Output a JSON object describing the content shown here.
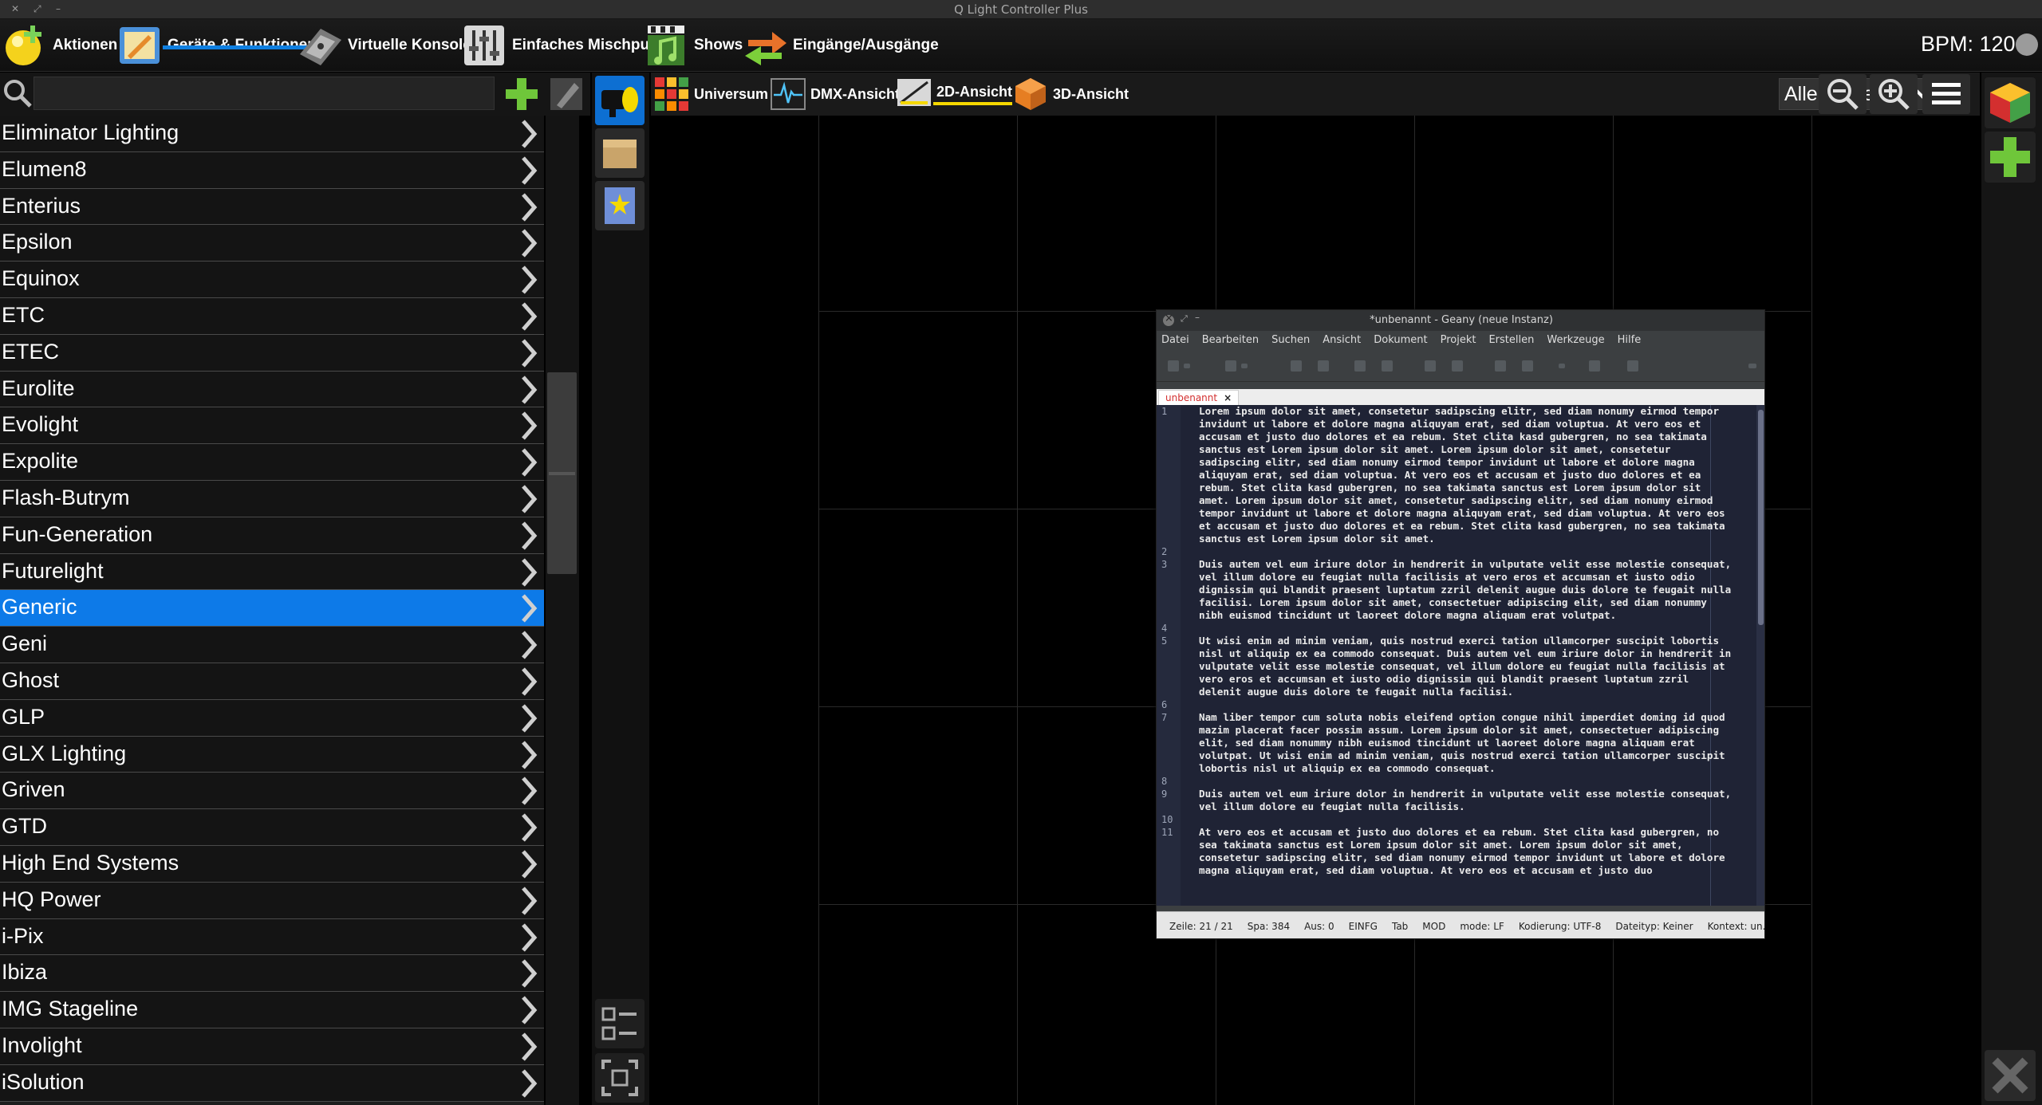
{
  "window": {
    "title": "Q Light Controller Plus"
  },
  "main_tabs": [
    {
      "label": "Aktionen",
      "icon": "bulb-icon"
    },
    {
      "label": "Geräte & Funktionen",
      "icon": "fixture-editor-icon",
      "active": true
    },
    {
      "label": "Virtuelle Konsole",
      "icon": "virtual-console-icon"
    },
    {
      "label": "Einfaches Mischpult",
      "icon": "mixer-icon"
    },
    {
      "label": "Shows",
      "icon": "shows-icon"
    },
    {
      "label": "Eingänge/Ausgänge",
      "icon": "io-arrows-icon"
    }
  ],
  "bpm": {
    "label": "BPM: 120"
  },
  "search": {
    "placeholder": "",
    "value": ""
  },
  "manufacturers": [
    "Eliminator Lighting",
    "Elumen8",
    "Enterius",
    "Epsilon",
    "Equinox",
    "ETC",
    "ETEC",
    "Eurolite",
    "Evolight",
    "Expolite",
    "Flash-Butrym",
    "Fun-Generation",
    "Futurelight",
    "Generic",
    "Geni",
    "Ghost",
    "GLP",
    "GLX Lighting",
    "Griven",
    "GTD",
    "High End Systems",
    "HQ Power",
    "i-Pix",
    "Ibiza",
    "IMG Stageline",
    "Involight",
    "iSolution"
  ],
  "selected_manufacturer": "Generic",
  "context_tabs": [
    {
      "label": "Universum",
      "icon": "universe-grid-icon"
    },
    {
      "label": "DMX-Ansicht",
      "icon": "dmx-wave-icon"
    },
    {
      "label": "2D-Ansicht",
      "icon": "view2d-icon",
      "active": true
    },
    {
      "label": "3D-Ansicht",
      "icon": "cube-icon"
    }
  ],
  "universe_select": {
    "value": "Alle Universen"
  },
  "colors": {
    "accent": "#0d7ae8",
    "active_tab_underline": "#f5d800",
    "list_bg": "#141414"
  },
  "geany": {
    "title": "*unbenannt - Geany (neue Instanz)",
    "menu": [
      "Datei",
      "Bearbeiten",
      "Suchen",
      "Ansicht",
      "Dokument",
      "Projekt",
      "Erstellen",
      "Werkzeuge",
      "Hilfe"
    ],
    "tab": "unbenannt",
    "lines": [
      {
        "no": "1",
        "text": "Lorem ipsum dolor sit amet, consetetur sadipscing elitr, sed diam nonumy eirmod tempor invidunt ut labore et dolore magna aliquyam erat, sed diam voluptua. At vero eos et accusam et justo duo dolores et ea rebum. Stet clita kasd gubergren, no sea takimata sanctus est Lorem ipsum dolor sit amet. Lorem ipsum dolor sit amet, consetetur sadipscing elitr, sed diam nonumy eirmod tempor invidunt ut labore et dolore magna aliquyam erat, sed diam voluptua. At vero eos et accusam et justo duo dolores et ea rebum. Stet clita kasd gubergren, no sea takimata sanctus est Lorem ipsum dolor sit amet. Lorem ipsum dolor sit amet, consetetur sadipscing elitr, sed diam nonumy eirmod tempor invidunt ut labore et dolore magna aliquyam erat, sed diam voluptua. At vero eos et accusam et justo duo dolores et ea rebum. Stet clita kasd gubergren, no sea takimata sanctus est Lorem ipsum dolor sit amet."
      },
      {
        "no": "2",
        "text": ""
      },
      {
        "no": "3",
        "text": "Duis autem vel eum iriure dolor in hendrerit in vulputate velit esse molestie consequat, vel illum dolore eu feugiat nulla facilisis at vero eros et accumsan et iusto odio dignissim qui blandit praesent luptatum zzril delenit augue duis dolore te feugait nulla facilisi. Lorem ipsum dolor sit amet, consectetuer adipiscing elit, sed diam nonummy nibh euismod tincidunt ut laoreet dolore magna aliquam erat volutpat."
      },
      {
        "no": "4",
        "text": ""
      },
      {
        "no": "5",
        "text": "Ut wisi enim ad minim veniam, quis nostrud exerci tation ullamcorper suscipit lobortis nisl ut aliquip ex ea commodo consequat. Duis autem vel eum iriure dolor in hendrerit in vulputate velit esse molestie consequat, vel illum dolore eu feugiat nulla facilisis at vero eros et accumsan et iusto odio dignissim qui blandit praesent luptatum zzril delenit augue duis dolore te feugait nulla facilisi."
      },
      {
        "no": "6",
        "text": ""
      },
      {
        "no": "7",
        "text": "Nam liber tempor cum soluta nobis eleifend option congue nihil imperdiet doming id quod mazim placerat facer possim assum. Lorem ipsum dolor sit amet, consectetuer adipiscing elit, sed diam nonummy nibh euismod tincidunt ut laoreet dolore magna aliquam erat volutpat. Ut wisi enim ad minim veniam, quis nostrud exerci tation ullamcorper suscipit lobortis nisl ut aliquip ex ea commodo consequat."
      },
      {
        "no": "8",
        "text": ""
      },
      {
        "no": "9",
        "text": "Duis autem vel eum iriure dolor in hendrerit in vulputate velit esse molestie consequat, vel illum dolore eu feugiat nulla facilisis."
      },
      {
        "no": "10",
        "text": ""
      },
      {
        "no": "11",
        "text": "At vero eos et accusam et justo duo dolores et ea rebum. Stet clita kasd gubergren, no sea takimata sanctus est Lorem ipsum dolor sit amet. Lorem ipsum dolor sit amet, consetetur sadipscing elitr, sed diam nonumy eirmod tempor invidunt ut labore et dolore magna aliquyam erat, sed diam voluptua. At vero eos et accusam et justo duo"
      }
    ],
    "status": [
      "Zeile: 21 / 21",
      "Spa: 384",
      "Aus: 0",
      "EINFG",
      "Tab",
      "MOD",
      "mode: LF",
      "Kodierung: UTF-8",
      "Dateityp: Keiner",
      "Kontext: un..."
    ]
  }
}
